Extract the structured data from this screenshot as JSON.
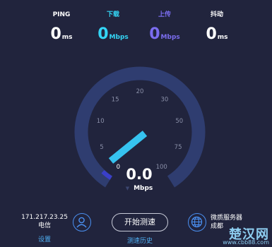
{
  "stats": [
    {
      "label": "PING",
      "value": "0",
      "unit": "ms",
      "color": "#ffffff"
    },
    {
      "label": "下载",
      "value": "0",
      "unit": "Mbps",
      "color": "#34d5f5"
    },
    {
      "label": "上传",
      "value": "0",
      "unit": "Mbps",
      "color": "#7b6df0"
    },
    {
      "label": "抖动",
      "value": "0",
      "unit": "ms",
      "color": "#ffffff"
    }
  ],
  "gauge": {
    "ticks": [
      "0",
      "5",
      "10",
      "15",
      "20",
      "30",
      "50",
      "75",
      "100"
    ],
    "value": "0.0",
    "unit": "Mbps",
    "arc_color": "#2f3d70",
    "needle_color": "#36c3f0",
    "low_color": "#3a3fc9"
  },
  "client": {
    "ip": "171.217.23.25",
    "isp": "电信",
    "settings_label": "设置"
  },
  "actions": {
    "start_label": "开始测速",
    "history_label": "测速历史"
  },
  "server": {
    "label": "微质服务器",
    "city": "成都"
  },
  "watermark": {
    "brand": "楚汉网",
    "url": "www.cbb88.com"
  }
}
